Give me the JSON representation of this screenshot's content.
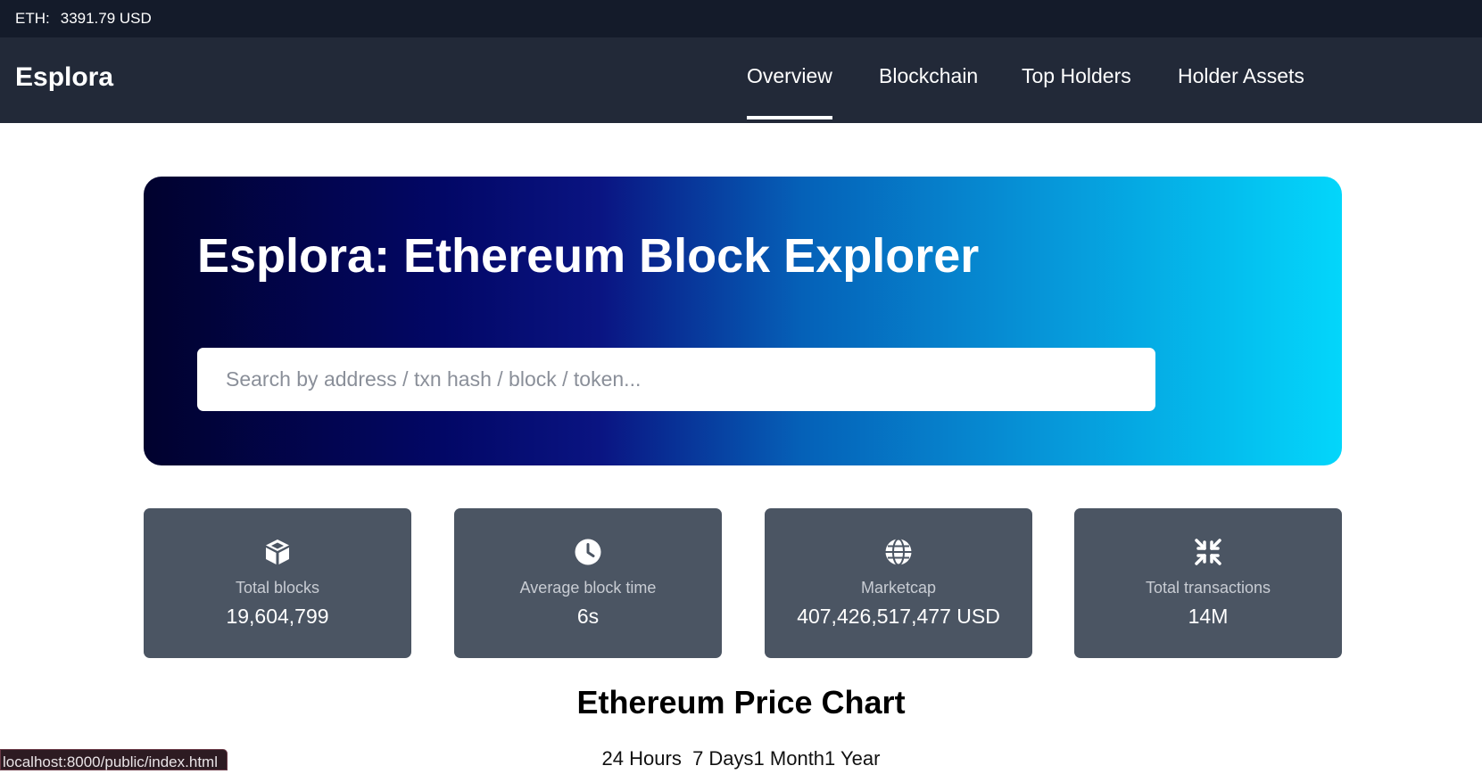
{
  "topbar": {
    "eth_label": "ETH:",
    "eth_price": "3391.79 USD"
  },
  "navbar": {
    "brand": "Esplora",
    "links": [
      {
        "label": "Overview",
        "active": true
      },
      {
        "label": "Blockchain",
        "active": false
      },
      {
        "label": "Top Holders",
        "active": false
      },
      {
        "label": "Holder Assets",
        "active": false
      }
    ]
  },
  "hero": {
    "title": "Esplora: Ethereum Block Explorer",
    "search_placeholder": "Search by address / txn hash / block / token..."
  },
  "stats": [
    {
      "icon": "cube-icon",
      "label": "Total blocks",
      "value": "19,604,799"
    },
    {
      "icon": "clock-icon",
      "label": "Average block time",
      "value": "6s"
    },
    {
      "icon": "globe-icon",
      "label": "Marketcap",
      "value": "407,426,517,477 USD"
    },
    {
      "icon": "compress-arrows-icon",
      "label": "Total transactions",
      "value": "14M"
    }
  ],
  "chart": {
    "title": "Ethereum Price Chart",
    "ranges": [
      "24 Hours",
      "7 Days",
      "1 Month",
      "1 Year"
    ]
  },
  "status_bar": {
    "url": "localhost:8000/public/index.html"
  },
  "colors": {
    "topbar_bg": "#141b2a",
    "navbar_bg": "#222938",
    "stat_card_bg": "#4b5563",
    "hero_gradient_start": "#01022e",
    "hero_gradient_end": "#03d6fb"
  }
}
